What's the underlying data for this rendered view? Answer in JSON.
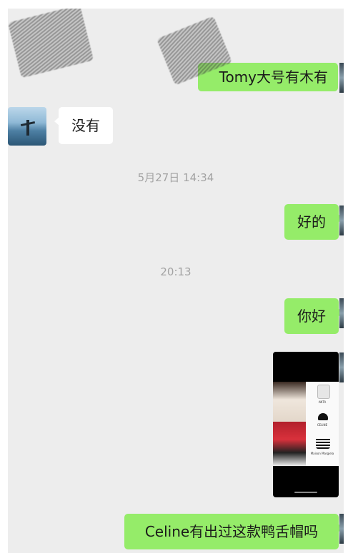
{
  "messages": {
    "top_partial": "Tomy大号有木有",
    "reply_no": "没有",
    "timestamp_1": "5月27日 14:34",
    "reply_ok": "好的",
    "timestamp_2": "20:13",
    "hello": "你好",
    "question": "Celine有出过这款鸭舌帽吗"
  },
  "image_message": {
    "labels": [
      "ANTA",
      "CELINE",
      "Maison Margiela"
    ]
  },
  "colors": {
    "my_bubble": "#95ec69",
    "their_bubble": "#ffffff",
    "background": "#ededed",
    "timestamp": "#a3a3a3"
  }
}
